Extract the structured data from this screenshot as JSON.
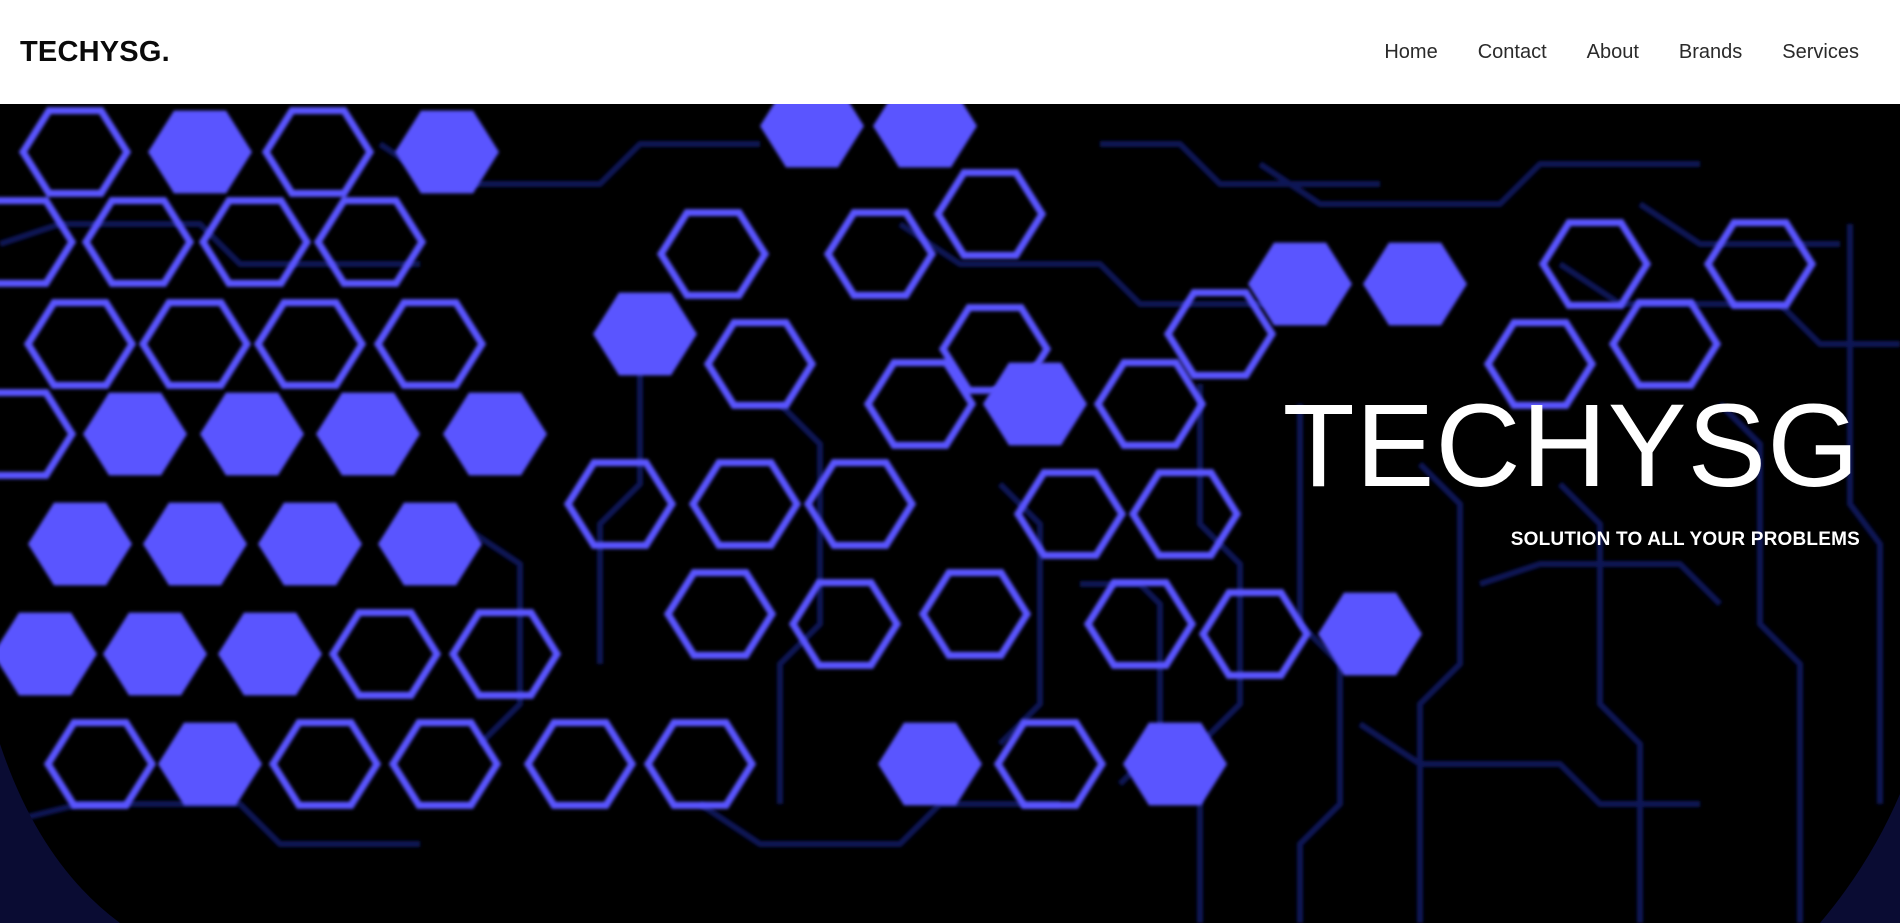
{
  "header": {
    "brand": "TECHYSG.",
    "nav": [
      {
        "label": "Home"
      },
      {
        "label": "Contact"
      },
      {
        "label": "About"
      },
      {
        "label": "Brands"
      },
      {
        "label": "Services"
      }
    ]
  },
  "hero": {
    "title": "TECHYSG",
    "subtitle": "SOLUTION TO ALL YOUR PROBLEMS",
    "background": "circuit-board-hexagon-pattern"
  },
  "colors": {
    "accent": "#5a55ff",
    "trace": "#0f1257",
    "background": "#000000",
    "navbar": "#ffffff"
  }
}
